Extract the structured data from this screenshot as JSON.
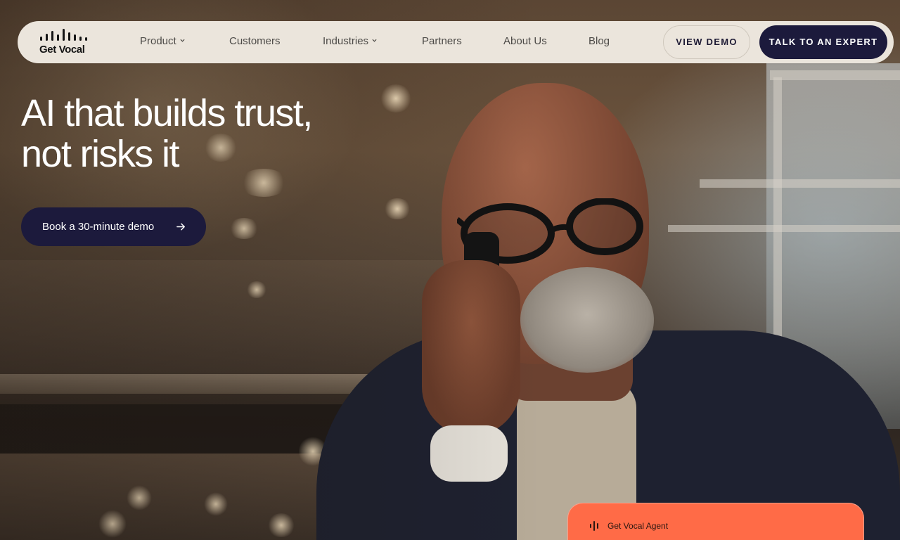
{
  "nav": {
    "logo_text": "Get Vocal",
    "items": [
      {
        "label": "Product",
        "has_dropdown": true
      },
      {
        "label": "Customers",
        "has_dropdown": false
      },
      {
        "label": "Industries",
        "has_dropdown": true
      },
      {
        "label": "Partners",
        "has_dropdown": false
      },
      {
        "label": "About Us",
        "has_dropdown": false
      },
      {
        "label": "Blog",
        "has_dropdown": false
      }
    ],
    "view_demo_label": "VIEW DEMO",
    "talk_expert_label": "TALK TO AN EXPERT"
  },
  "hero": {
    "headline_line1": "AI that builds trust,",
    "headline_line2": "not risks it",
    "cta_label": "Book a 30-minute demo",
    "background_image": "man-smiling-on-phone-call"
  },
  "agent_card": {
    "label": "Get Vocal Agent"
  },
  "colors": {
    "nav_bg": "#ebe5dc",
    "primary_dark": "#1c1a3c",
    "agent_card": "#ff6b47",
    "headline": "#ffffff"
  },
  "icons": {
    "logo": "sound-wave-logo-icon",
    "dropdown": "chevron-down-icon",
    "cta": "arrow-right-icon",
    "agent": "sound-wave-icon"
  }
}
